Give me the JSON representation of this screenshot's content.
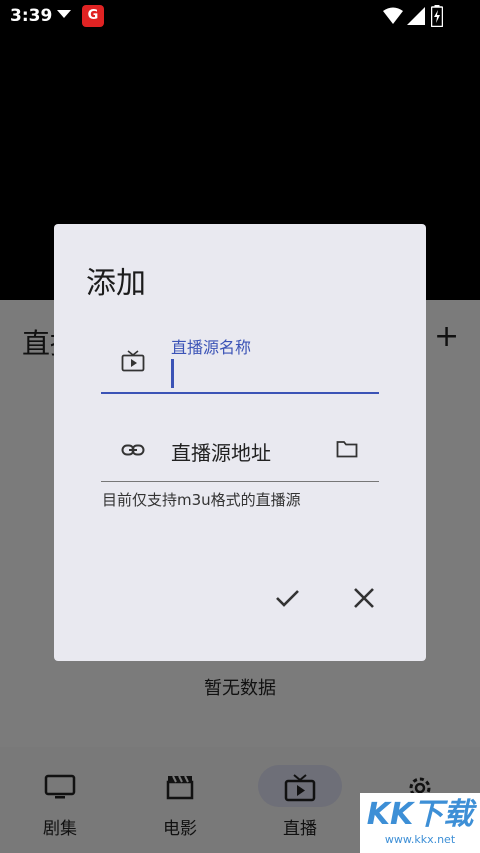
{
  "status_bar": {
    "time": "3:39",
    "app_badge": "G"
  },
  "app": {
    "title": "直播",
    "add_label": "+",
    "empty_text": "暂无数据"
  },
  "bottom_nav": {
    "items": [
      {
        "label": "剧集",
        "icon": "tv-icon"
      },
      {
        "label": "电影",
        "icon": "clapperboard-icon"
      },
      {
        "label": "直播",
        "icon": "live-tv-icon",
        "active": true
      },
      {
        "label": "",
        "icon": "settings-gear-icon"
      }
    ]
  },
  "dialog": {
    "title": "添加",
    "name_field": {
      "label": "直播源名称",
      "value": ""
    },
    "url_field": {
      "placeholder": "直播源地址"
    },
    "helper_text": "目前仅支持m3u格式的直播源",
    "confirm_icon": "check-icon",
    "cancel_icon": "close-icon"
  },
  "watermark": {
    "text": "KK下载",
    "sub": "www.kkx.net"
  },
  "colors": {
    "accent": "#3b53b6",
    "dialog_bg": "#e9e9f0",
    "scrim": "#7b7b7b"
  }
}
